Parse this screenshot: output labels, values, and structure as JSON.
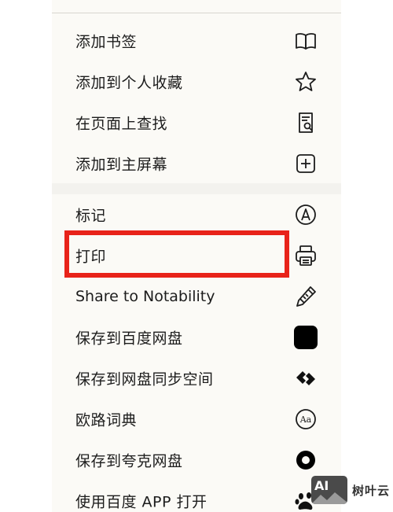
{
  "menu": {
    "items": [
      {
        "label": "添加书签",
        "icon": "book-icon"
      },
      {
        "label": "添加到个人收藏",
        "icon": "star-icon"
      },
      {
        "label": "在页面上查找",
        "icon": "find-in-page-icon"
      },
      {
        "label": "添加到主屏幕",
        "icon": "add-square-icon"
      },
      {
        "label": "标记",
        "icon": "markup-pen-icon"
      },
      {
        "label": "打印",
        "icon": "printer-icon"
      },
      {
        "label": "Share to Notability",
        "icon": "pencil-icon"
      },
      {
        "label": "保存到百度网盘",
        "icon": "black-square-icon"
      },
      {
        "label": "保存到网盘同步空间",
        "icon": "sync-space-icon"
      },
      {
        "label": "欧路词典",
        "icon": "dictionary-aa-icon"
      },
      {
        "label": "保存到夸克网盘",
        "icon": "quark-icon"
      },
      {
        "label": "使用百度 APP 打开",
        "icon": "baidu-paw-icon"
      }
    ]
  },
  "highlight_color": "#e8231a",
  "watermark": {
    "logo_text": "AI",
    "site_name": "树叶云"
  }
}
